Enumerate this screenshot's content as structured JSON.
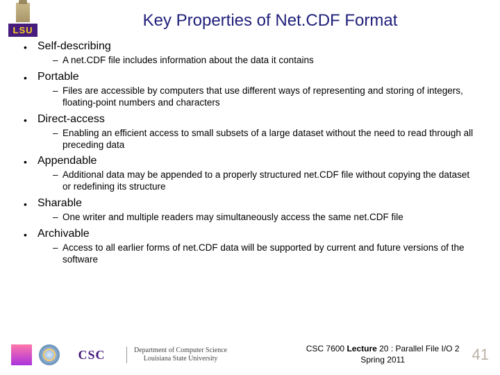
{
  "logo_text": "LSU",
  "title": "Key Properties of Net.CDF Format",
  "items": [
    {
      "term": "Self-describing",
      "desc": "A net.CDF file includes information about the data it contains"
    },
    {
      "term": "Portable",
      "desc": "Files are accessible by computers that use different ways of representing and storing of integers, floating-point numbers and characters"
    },
    {
      "term": "Direct-access",
      "desc": "Enabling an efficient access to small subsets of a large dataset without the need to read through all preceding data"
    },
    {
      "term": "Appendable",
      "desc": "Additional data may be appended to a properly structured net.CDF file without copying the dataset or redefining its structure"
    },
    {
      "term": "Sharable",
      "desc": "One writer and multiple readers may simultaneously access the same net.CDF file"
    },
    {
      "term": "Archivable",
      "desc": "Access to all earlier forms of net.CDF data will be supported by current and future versions of the software"
    }
  ],
  "footer": {
    "csc": "CSC",
    "dept_l1": "Department of Computer Science",
    "dept_l2": "Louisiana State University",
    "course": "CSC 7600 ",
    "lecture_b": "Lecture",
    "lecture_rest": " 20 : Parallel File I/O 2",
    "term": "Spring 2011",
    "page": "41"
  }
}
